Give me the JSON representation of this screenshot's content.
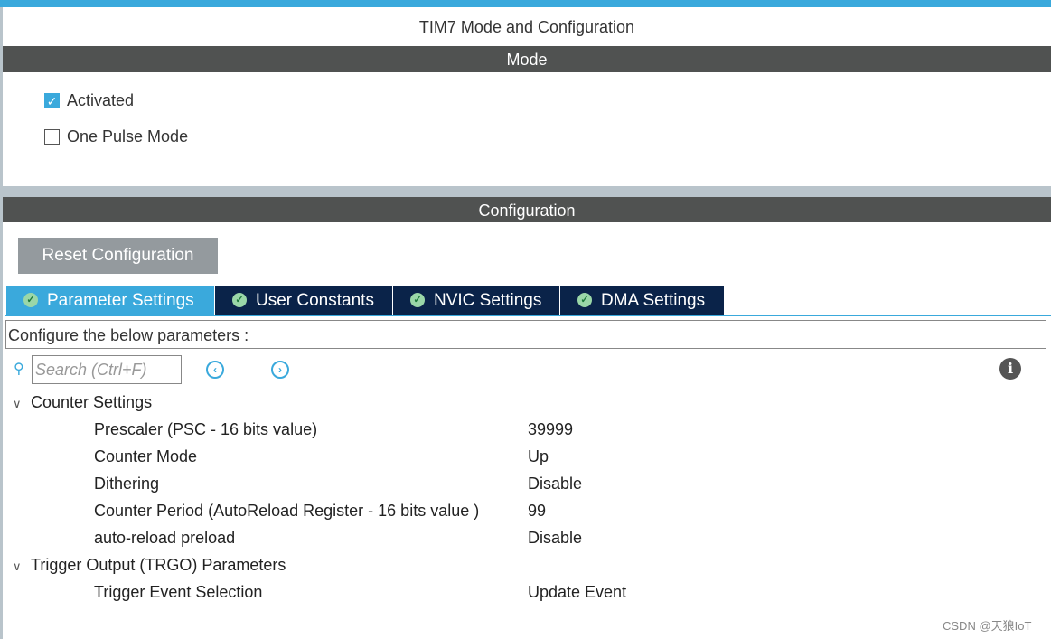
{
  "title": "TIM7 Mode and Configuration",
  "mode": {
    "header": "Mode",
    "options": [
      {
        "label": "Activated",
        "checked": true
      },
      {
        "label": "One Pulse Mode",
        "checked": false
      }
    ]
  },
  "configuration": {
    "header": "Configuration",
    "reset_label": "Reset Configuration",
    "tabs": [
      {
        "label": "Parameter Settings",
        "active": true
      },
      {
        "label": "User Constants"
      },
      {
        "label": "NVIC Settings"
      },
      {
        "label": "DMA Settings"
      }
    ],
    "configure_text": "Configure the below parameters :",
    "search_placeholder": "Search (Ctrl+F)",
    "groups": [
      {
        "name": "Counter Settings",
        "params": [
          {
            "name": "Prescaler (PSC - 16 bits value)",
            "value": "39999"
          },
          {
            "name": "Counter Mode",
            "value": "Up"
          },
          {
            "name": "Dithering",
            "value": "Disable"
          },
          {
            "name": "Counter Period (AutoReload Register - 16 bits value )",
            "value": "99"
          },
          {
            "name": "auto-reload preload",
            "value": "Disable"
          }
        ]
      },
      {
        "name": "Trigger Output (TRGO) Parameters",
        "params": [
          {
            "name": "Trigger Event Selection",
            "value": "Update Event"
          }
        ]
      }
    ]
  },
  "watermark": "CSDN @天狼IoT",
  "colors": {
    "accent": "#3aa9dc",
    "header": "#505251",
    "tab": "#0a2349"
  }
}
